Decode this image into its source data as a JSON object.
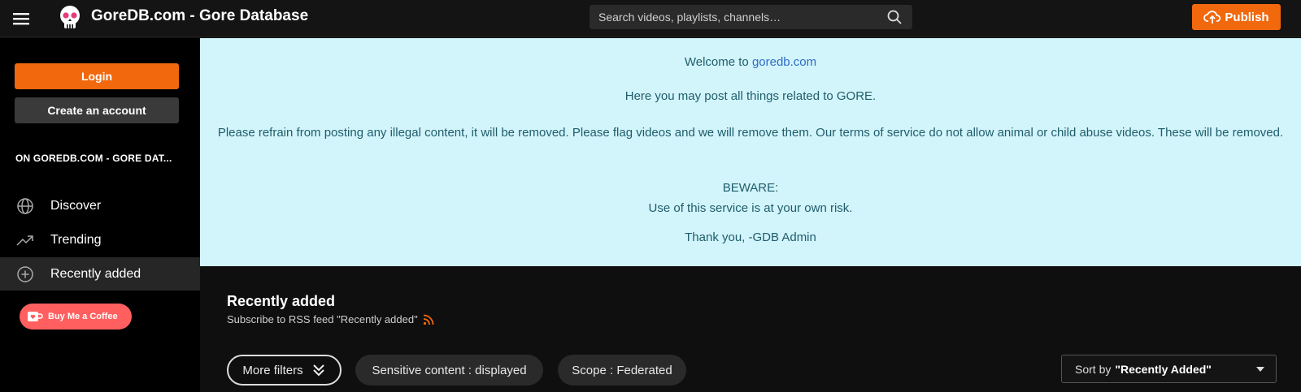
{
  "header": {
    "title": "GoreDB.com - Gore Database",
    "search_placeholder": "Search videos, playlists, channels…",
    "publish_label": "Publish"
  },
  "sidebar": {
    "login_label": "Login",
    "create_account_label": "Create an account",
    "section_title": "ON GOREDB.COM - GORE DAT...",
    "items": [
      {
        "label": "Discover",
        "icon": "globe-icon"
      },
      {
        "label": "Trending",
        "icon": "trending-icon"
      },
      {
        "label": "Recently added",
        "icon": "plus-circle-icon",
        "active": true
      }
    ],
    "coffee_label": "Buy Me a Coffee"
  },
  "notice": {
    "welcome_prefix": "Welcome to ",
    "welcome_link": "goredb.com",
    "post_line": "Here you may post all things related to GORE.",
    "refrain_line": "Please refrain from posting any illegal content, it will be removed. Please flag videos and we will remove them. Our terms of service do not allow animal or child abuse videos. These will be removed.",
    "beware_title": "BEWARE:",
    "beware_line": "Use of this service is at your own risk.",
    "thanks_line": "Thank you, -GDB Admin"
  },
  "content": {
    "section_title": "Recently added",
    "rss_label": "Subscribe to RSS feed \"Recently added\"",
    "filters": {
      "more_filters": "More filters",
      "sensitive": "Sensitive content : displayed",
      "scope": "Scope : Federated"
    },
    "sort_prefix": "Sort by",
    "sort_value": "\"Recently Added\""
  },
  "colors": {
    "accent": "#f1680d",
    "notice_bg": "#d2f4fb",
    "notice_text": "#1f5d6b",
    "coffee": "#ff5f5f"
  }
}
